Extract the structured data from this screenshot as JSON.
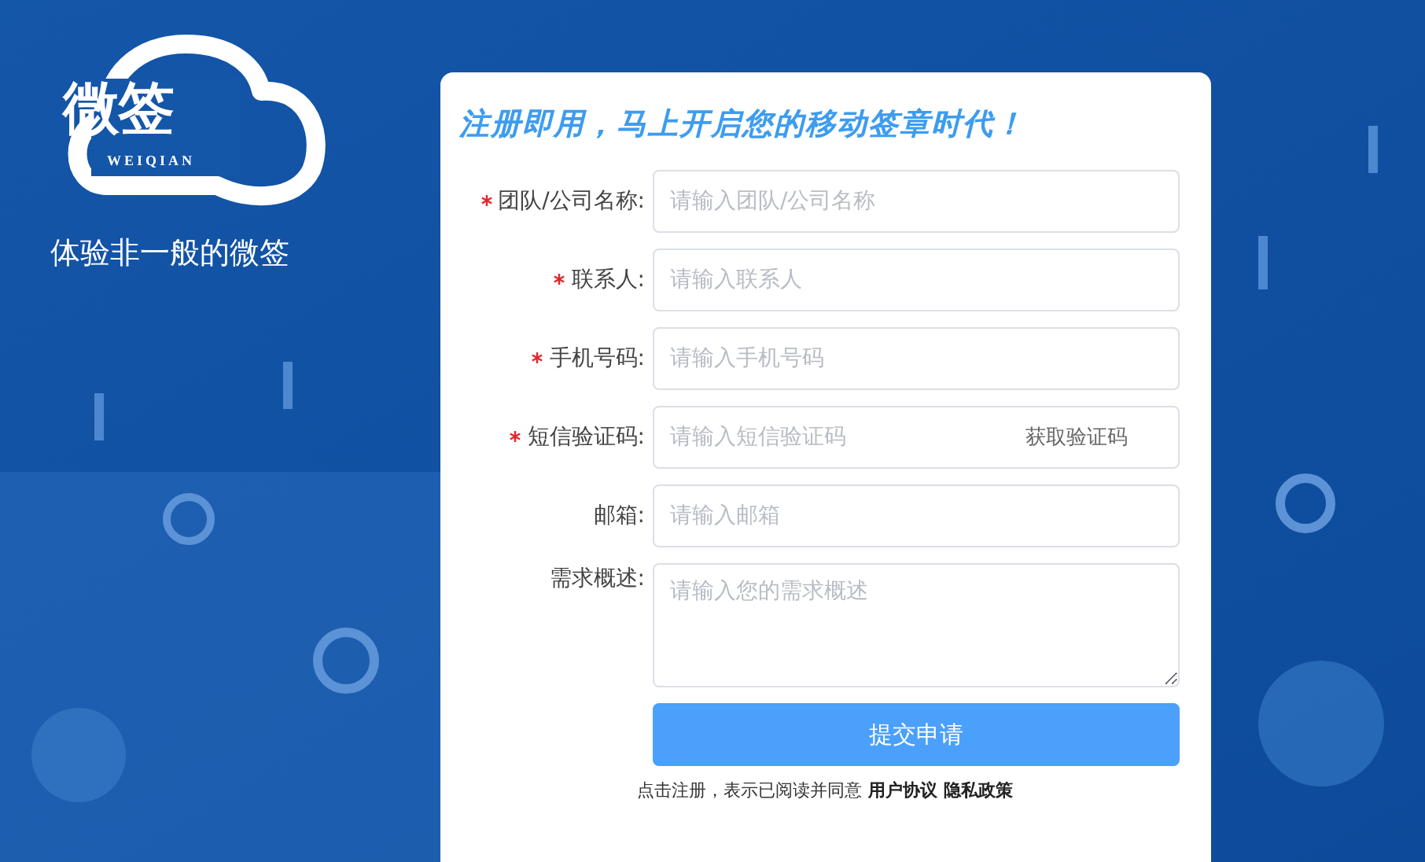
{
  "logo": {
    "name": "微签",
    "subtitle": "WEIQIAN"
  },
  "tagline": "体验非一般的微签",
  "form": {
    "heading": "注册即用，马上开启您的移动签章时代！",
    "fields": [
      {
        "kind": "text",
        "label": "团队/公司名称:",
        "required": true,
        "placeholder": "请输入团队/公司名称"
      },
      {
        "kind": "text",
        "label": "联系人:",
        "required": true,
        "placeholder": "请输入联系人"
      },
      {
        "kind": "text",
        "label": "手机号码:",
        "required": true,
        "placeholder": "请输入手机号码"
      },
      {
        "kind": "code",
        "label": "短信验证码:",
        "required": true,
        "placeholder": "请输入短信验证码",
        "action": "获取验证码"
      },
      {
        "kind": "text",
        "label": "邮箱:",
        "required": false,
        "placeholder": "请输入邮箱"
      },
      {
        "kind": "textarea",
        "label": "需求概述:",
        "required": false,
        "placeholder": "请输入您的需求概述"
      }
    ],
    "submit": "提交申请",
    "agreement": {
      "text": "点击注册，表示已阅读并同意",
      "links": [
        "用户协议",
        "隐私政策"
      ]
    }
  }
}
